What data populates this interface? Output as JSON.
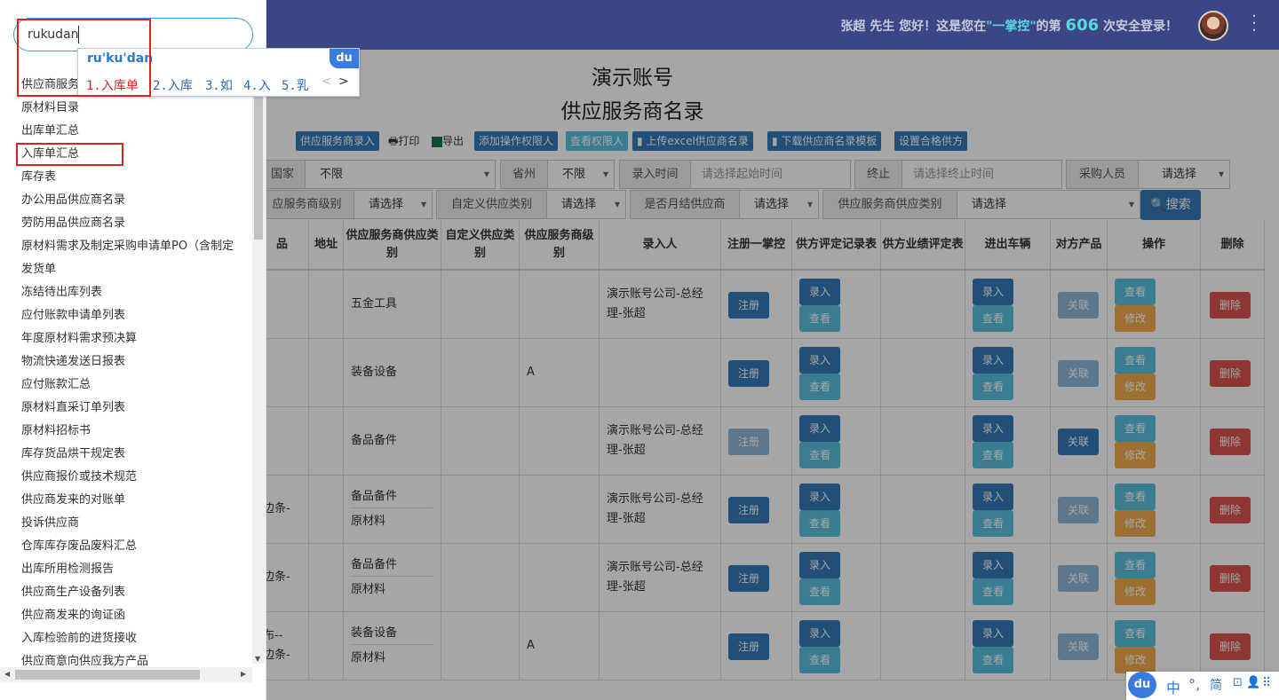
{
  "header": {
    "welcome_pre": "张超 先生 您好！这是您在",
    "brand": "\"一掌控\"",
    "welcome_mid": "的第",
    "login_count": "606",
    "welcome_post": "次安全登录！"
  },
  "page": {
    "company": "演示账号",
    "title": "供应服务商名录"
  },
  "toolbar": {
    "add": "供应服务商录入",
    "print": "打印",
    "export": "导出",
    "add_perm": "添加操作权限人",
    "view_perm": "查看权限人",
    "upload": "上传excel供应商名录",
    "download": "下载供应商名录模板",
    "qualified": "设置合格供方"
  },
  "filters": {
    "country_label": "国家",
    "country_value": "不限",
    "province_label": "省州",
    "province_value": "不限",
    "entry_time_label": "录入时间",
    "start_placeholder": "请选择起始时间",
    "end_label": "终止",
    "end_placeholder": "请选择终止时间",
    "buyer_label": "采购人员",
    "buyer_value": "请选择",
    "level_label": "应服务商级别",
    "level_value": "请选择",
    "custom_label": "自定义供应类别",
    "custom_value": "请选择",
    "monthly_label": "是否月结供应商",
    "monthly_value": "请选择",
    "category_label": "供应服务商供应类别",
    "category_value": "请选择",
    "search_btn": "搜索"
  },
  "table": {
    "headers": [
      "品",
      "地址",
      "供应服务商供应类别",
      "自定义供应类别",
      "供应服务商级别",
      "录入人",
      "注册一掌控",
      "供方评定记录表",
      "供方业绩评定表",
      "进出车辆",
      "对方产品",
      "操作",
      "删除"
    ],
    "rows": [
      {
        "name": "",
        "cat1": "五金工具",
        "cat2": "",
        "level": "",
        "entrant": "演示账号公司-总经理-张超"
      },
      {
        "name": "",
        "cat1": "装备设备",
        "cat2": "",
        "level": "A",
        "entrant": ""
      },
      {
        "name": "",
        "cat1": "备品备件",
        "cat2": "",
        "level": "",
        "entrant": "演示账号公司-总经理-张超"
      },
      {
        "name": "边条-",
        "cat1": "备品备件",
        "cat2": "原材料",
        "level": "",
        "entrant": "演示账号公司-总经理-张超"
      },
      {
        "name": "边条-",
        "cat1": "备品备件",
        "cat2": "原材料",
        "level": "",
        "entrant": "演示账号公司-总经理-张超"
      },
      {
        "name": "布--\n边条-",
        "cat1": "装备设备",
        "cat2": "原材料",
        "level": "A",
        "entrant": ""
      }
    ],
    "btn_register": "注册",
    "btn_enter": "录入",
    "btn_view": "查看",
    "btn_link": "关联",
    "btn_edit": "修改",
    "btn_delete": "删除"
  },
  "panel": {
    "search_value": "rukudan",
    "items": [
      "供应商服务",
      "原材料目录",
      "出库单汇总",
      "入库单汇总",
      "库存表",
      "办公用品供应商名录",
      "劳防用品供应商名录",
      "原材料需求及制定采购申请单PO（含制定",
      "发货单",
      "冻结待出库列表",
      "应付账款申请单列表",
      "年度原材料需求预决算",
      "物流快递发送日报表",
      "应付账款汇总",
      "原材料直采订单列表",
      "原材料招标书",
      "库存货品烘干规定表",
      "供应商报价或技术规范",
      "供应商发来的对账单",
      "投诉供应商",
      "仓库库存废品废料汇总",
      "出库所用检测报告",
      "供应商生产设备列表",
      "供应商发来的询证函",
      "入库检验前的进货接收",
      "供应商意向供应我方产品"
    ]
  },
  "ime": {
    "pinyin": "ru'ku'dan",
    "candidates": [
      "1.入库单",
      "2.入库",
      "3.如",
      "4.入",
      "5.乳"
    ],
    "logo": "du",
    "status": [
      "中",
      "°,",
      "简",
      "⊡",
      "👤",
      "⠿"
    ]
  }
}
